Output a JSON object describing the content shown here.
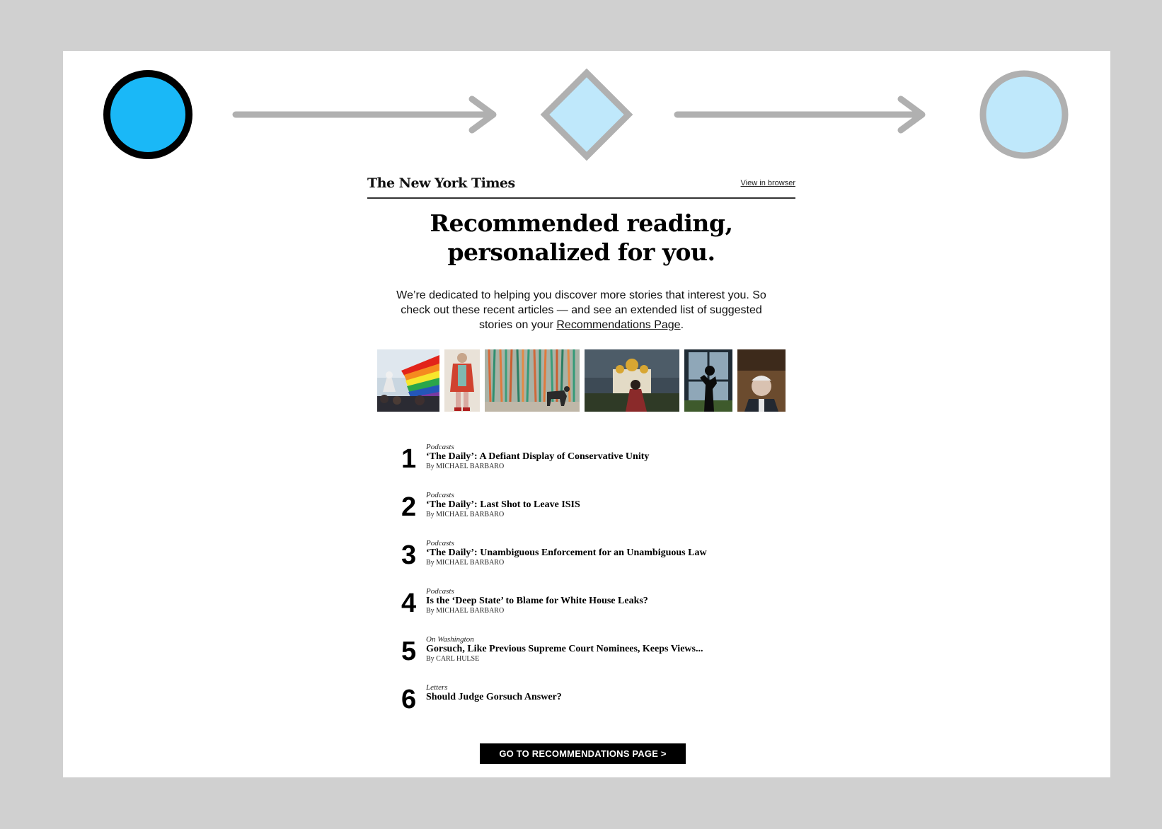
{
  "flow": {
    "start_color": "#1ab8f7",
    "inactive_fill": "#bfe8fb",
    "inactive_stroke": "#b0b0b0"
  },
  "email": {
    "logo": "The New York Times",
    "view_in_browser": "View in browser",
    "headline_line1": "Recommended reading,",
    "headline_line2": "personalized for you.",
    "intro_text": "We’re dedicated to helping you discover more stories that interest you. So check out these recent articles — and see an extended list of suggested stories on your ",
    "intro_link": "Recommendations Page",
    "intro_end": ".",
    "articles": [
      {
        "num": "1",
        "section": "Podcasts",
        "title": "‘The Daily’: A Defiant Display of Conservative Unity",
        "byline": "By MICHAEL BARBARO"
      },
      {
        "num": "2",
        "section": "Podcasts",
        "title": "‘The Daily’: Last Shot to Leave ISIS",
        "byline": "By MICHAEL BARBARO"
      },
      {
        "num": "3",
        "section": "Podcasts",
        "title": "‘The Daily’: Unambiguous Enforcement for an Unambiguous Law",
        "byline": "By MICHAEL BARBARO"
      },
      {
        "num": "4",
        "section": "Podcasts",
        "title": "Is the ‘Deep State’ to Blame for White House Leaks?",
        "byline": "By MICHAEL BARBARO"
      },
      {
        "num": "5",
        "section": "On Washington",
        "title": "Gorsuch, Like Previous Supreme Court Nominees, Keeps Views...",
        "byline": "By CARL HULSE"
      },
      {
        "num": "6",
        "section": "Letters",
        "title": "Should Judge Gorsuch Answer?",
        "byline": ""
      }
    ],
    "cta_label": "GO TO RECOMMENDATIONS PAGE",
    "cta_arrow": ">"
  }
}
